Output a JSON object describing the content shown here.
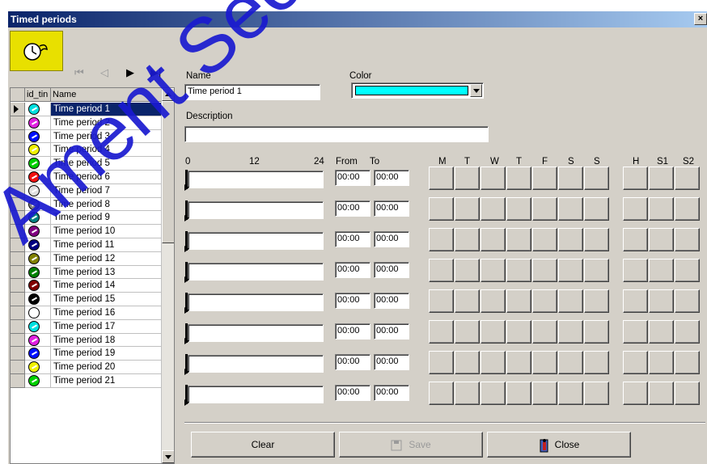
{
  "window": {
    "title": "Timed periods",
    "close_label": "×"
  },
  "toolbar": {
    "nav_first": "⏮",
    "nav_prev": "◁",
    "nav_next": "▶",
    "nav_last": "▶|"
  },
  "grid": {
    "col_id": "id_tin",
    "col_name": "Name",
    "rows": [
      {
        "name": "Time period 1",
        "color": "#00e0e0",
        "selected": true
      },
      {
        "name": "Time period 2",
        "color": "#e020e0"
      },
      {
        "name": "Time period 3",
        "color": "#0010ff"
      },
      {
        "name": "Time period 4",
        "color": "#f0f000"
      },
      {
        "name": "Time period 5",
        "color": "#00d000"
      },
      {
        "name": "Time period 6",
        "color": "#f01010"
      },
      {
        "name": "Time period 7",
        "color": "#e0e0e0"
      },
      {
        "name": "Time period 8",
        "color": "#808080"
      },
      {
        "name": "Time period 9",
        "color": "#008080"
      },
      {
        "name": "Time period 10",
        "color": "#800080"
      },
      {
        "name": "Time period 11",
        "color": "#000080"
      },
      {
        "name": "Time period 12",
        "color": "#808000"
      },
      {
        "name": "Time period 13",
        "color": "#008000"
      },
      {
        "name": "Time period 14",
        "color": "#800000"
      },
      {
        "name": "Time period 15",
        "color": "#000000"
      },
      {
        "name": "Time period 16",
        "color": "#ffffff"
      },
      {
        "name": "Time period 17",
        "color": "#00e0e0"
      },
      {
        "name": "Time period 18",
        "color": "#e020e0"
      },
      {
        "name": "Time period 19",
        "color": "#0010ff"
      },
      {
        "name": "Time period 20",
        "color": "#f0f000"
      },
      {
        "name": "Time period 21",
        "color": "#00d000"
      }
    ]
  },
  "form": {
    "name_label": "Name",
    "name_value": "Time period 1",
    "color_label": "Color",
    "color_value": "#00ffff",
    "description_label": "Description",
    "description_value": ""
  },
  "schedule": {
    "scale_0": "0",
    "scale_12": "12",
    "scale_24": "24",
    "from_label": "From",
    "to_label": "To",
    "day_labels": [
      "M",
      "T",
      "W",
      "T",
      "F",
      "S",
      "S"
    ],
    "extra_labels": [
      "H",
      "S1",
      "S2"
    ],
    "rows": [
      {
        "from": "00:00",
        "to": "00:00"
      },
      {
        "from": "00:00",
        "to": "00:00"
      },
      {
        "from": "00:00",
        "to": "00:00"
      },
      {
        "from": "00:00",
        "to": "00:00"
      },
      {
        "from": "00:00",
        "to": "00:00"
      },
      {
        "from": "00:00",
        "to": "00:00"
      },
      {
        "from": "00:00",
        "to": "00:00"
      },
      {
        "from": "00:00",
        "to": "00:00"
      }
    ]
  },
  "buttons": {
    "clear": "Clear",
    "save": "Save",
    "close": "Close"
  },
  "watermark": "Ament Security & Fire"
}
